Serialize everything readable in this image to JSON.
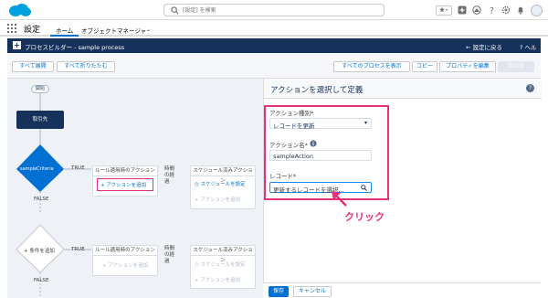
{
  "app": {
    "name": "設定"
  },
  "search": {
    "placeholder": "[設定] を検索"
  },
  "nav": {
    "tabs": [
      {
        "label": "ホーム"
      },
      {
        "label": "オブジェクトマネージャ"
      }
    ]
  },
  "header": {
    "title": "プロセスビルダー - sample process",
    "back_label": "設定に戻る",
    "help_label": "ヘルプ"
  },
  "toolbar": {
    "expand_all": "すべて展開",
    "collapse_all": "すべて折りたたむ",
    "show_all_processes": "すべてのプロセスを表示",
    "copy": "コピー",
    "edit_properties": "プロパティを編集",
    "activate": "有効化"
  },
  "canvas": {
    "start": "開始",
    "object_node": "取引先",
    "criteria_node": "sampleCriteria",
    "add_criteria": "条件を追加",
    "true_label": "TRUE",
    "false_label": "FALSE",
    "immediate_header": "ルール適用時のアクション",
    "elapsed_label": "時間の経過",
    "scheduled_header": "スケジュール済みアクション",
    "add_action": "アクションを追加",
    "set_schedule": "スケジュールを設定"
  },
  "panel": {
    "title": "アクションを選択して定義",
    "action_type_label": "アクション種別*",
    "action_type_value": "レコードを更新",
    "action_name_label": "アクション名*",
    "action_name_value": "sampleAction",
    "record_label": "レコード*",
    "record_placeholder": "更新するレコードを選択...",
    "save": "保存",
    "cancel": "キャンセル"
  },
  "annotation": {
    "click": "クリック"
  },
  "colors": {
    "header_bg": "#16325c",
    "accent": "#0070d2",
    "highlight": "#e5327a"
  }
}
